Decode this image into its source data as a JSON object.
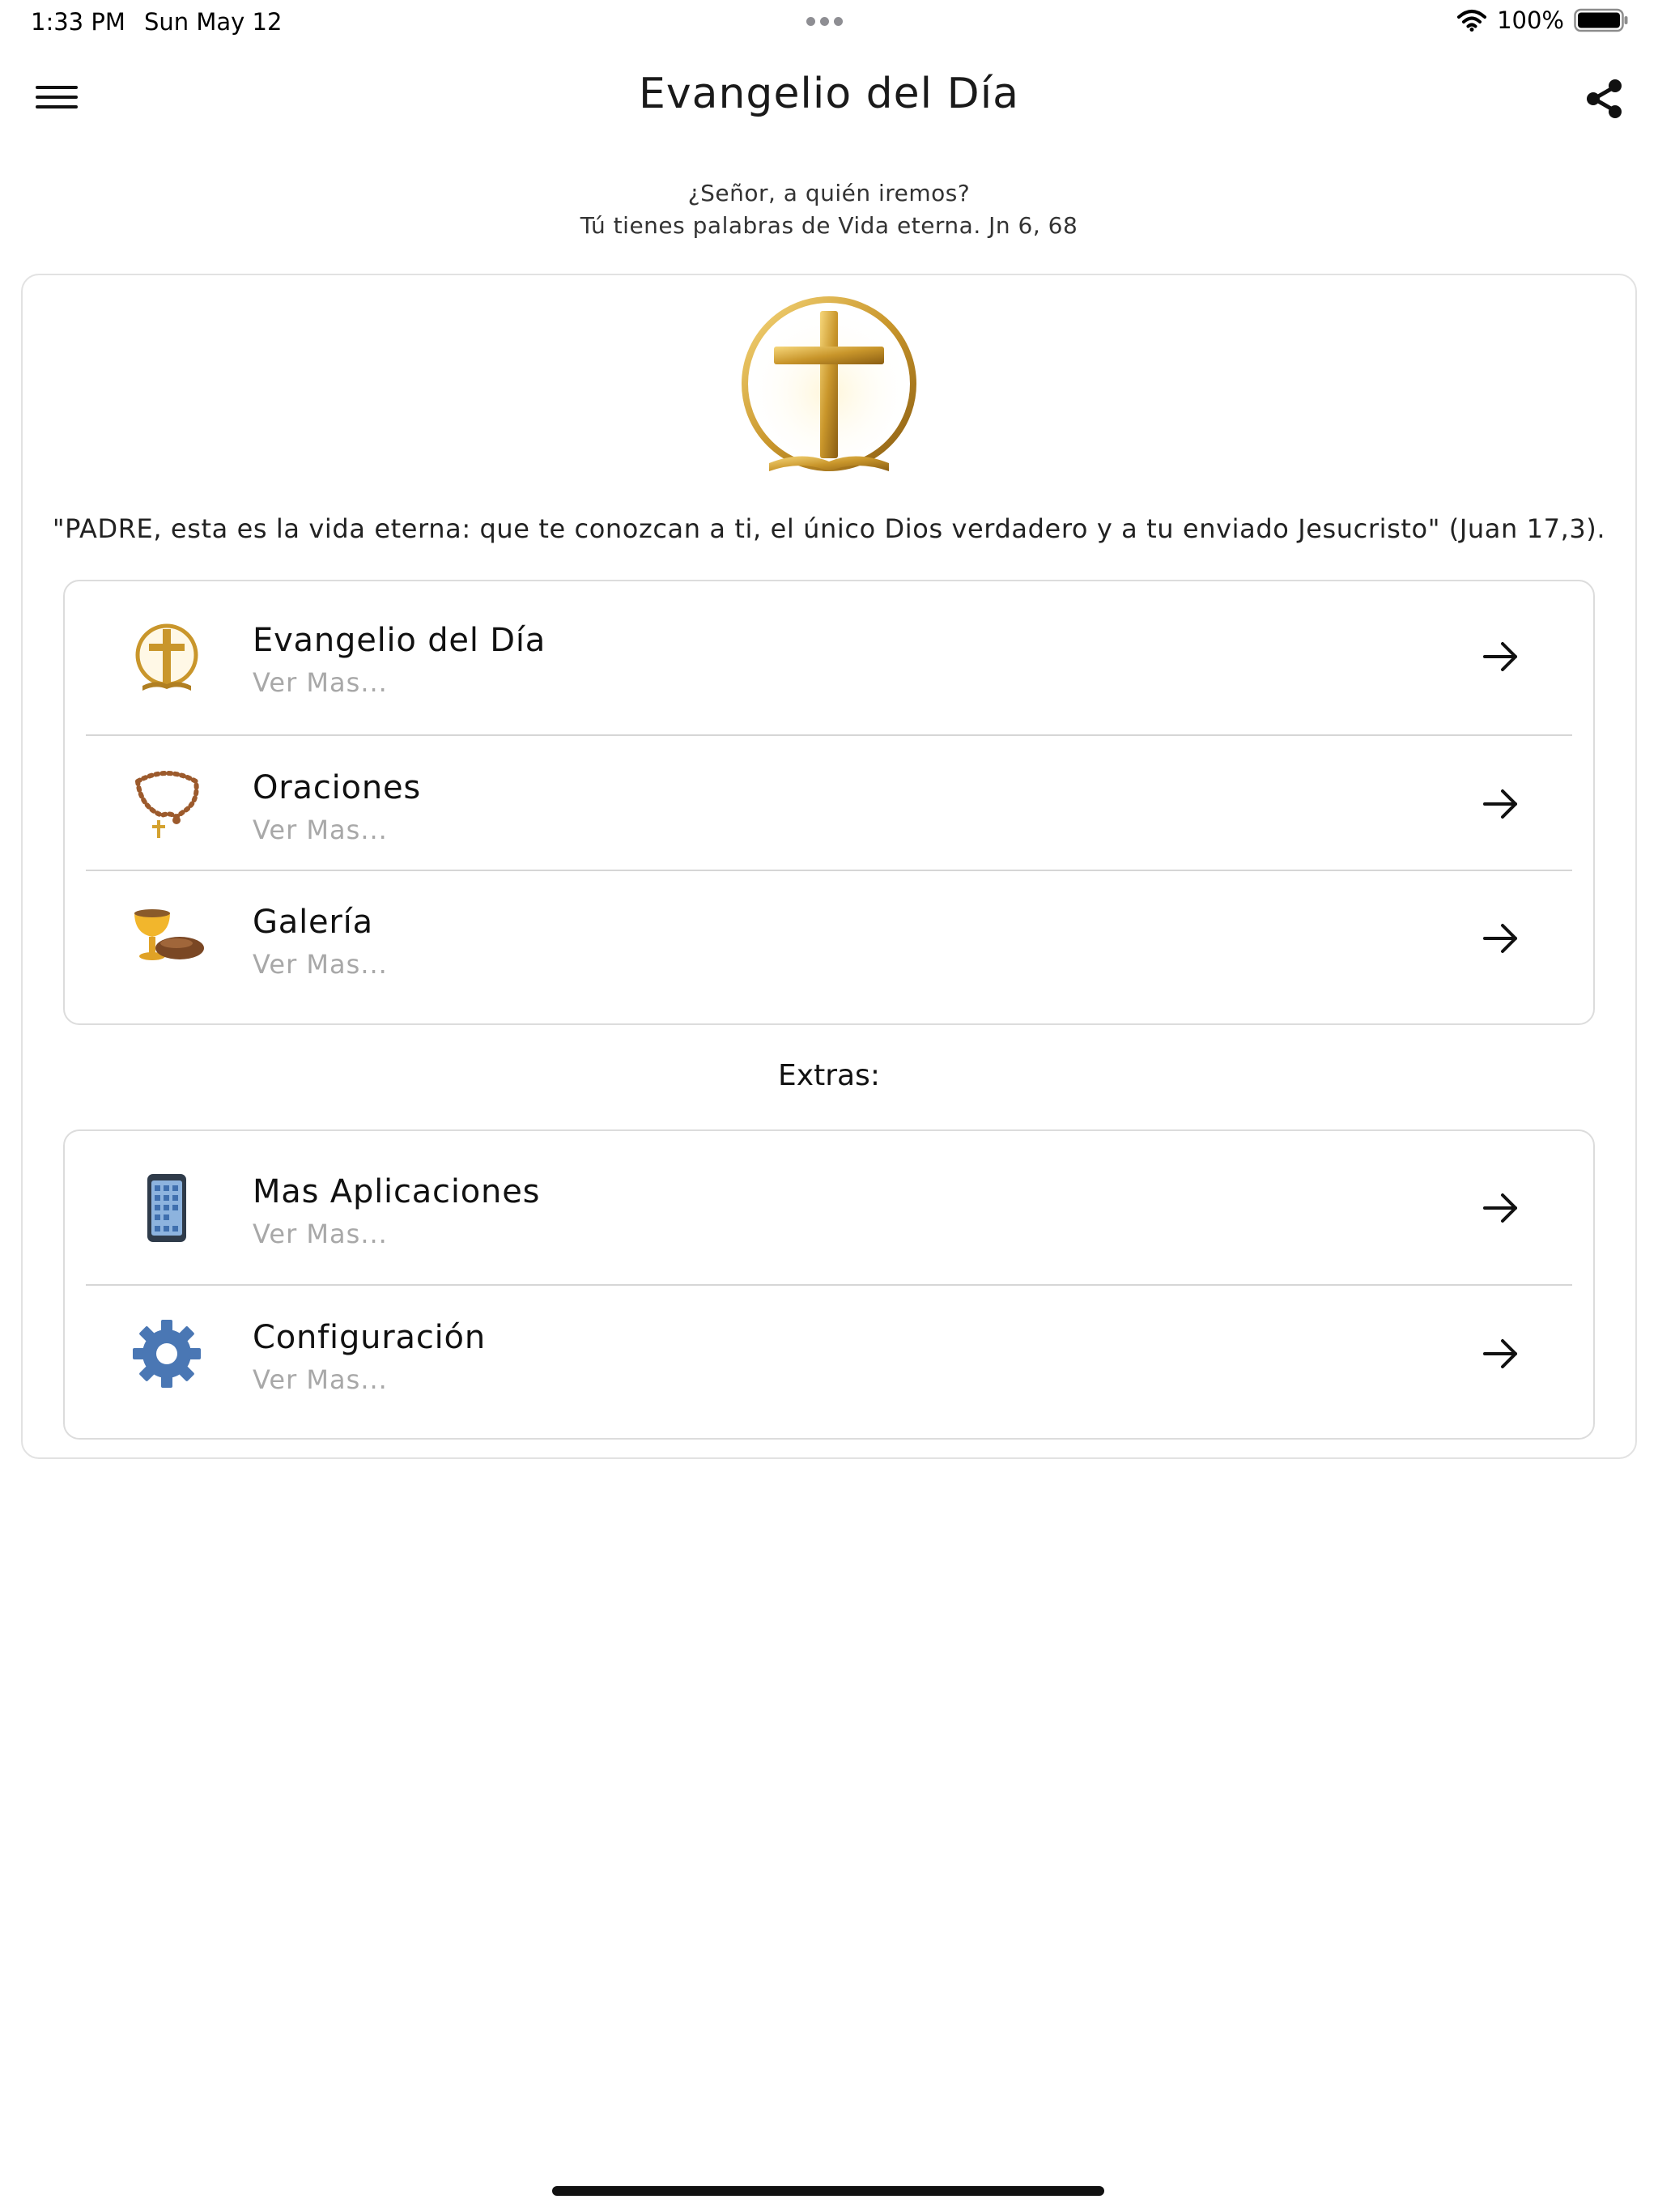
{
  "status_bar": {
    "time": "1:33 PM",
    "date": "Sun May 12",
    "battery": "100%",
    "icons": [
      "wifi-icon",
      "battery-icon"
    ]
  },
  "nav": {
    "title": "Evangelio del Día",
    "menu_icon": "hamburger-menu-icon",
    "share_icon": "share-icon"
  },
  "header": {
    "line1": "¿Señor, a quién iremos?",
    "line2": "Tú tienes palabras de Vida eterna. Jn 6, 68"
  },
  "logo": {
    "icon": "golden-cross-icon"
  },
  "verse": "\"PADRE, esta es la vida eterna: que te conozcan a ti, el único Dios verdadero y a tu enviado Jesucristo\" (Juan 17,3).",
  "main_list": [
    {
      "label": "Evangelio del Día",
      "sub": "Ver Mas...",
      "icon": "cross-icon"
    },
    {
      "label": "Oraciones",
      "sub": "Ver Mas...",
      "icon": "rosary-icon"
    },
    {
      "label": "Galería",
      "sub": "Ver Mas...",
      "icon": "chalice-bread-icon"
    }
  ],
  "extras": {
    "label": "Extras:",
    "items": [
      {
        "label": "Mas Aplicaciones",
        "sub": "Ver Mas...",
        "icon": "phone-apps-icon"
      },
      {
        "label": "Configuración",
        "sub": "Ver Mas...",
        "icon": "gear-icon"
      }
    ]
  },
  "colors": {
    "gold": "#c9962b",
    "border": "#dcdcdc",
    "muted_text": "#a8a8a8",
    "gear_blue": "#4a77b4"
  }
}
